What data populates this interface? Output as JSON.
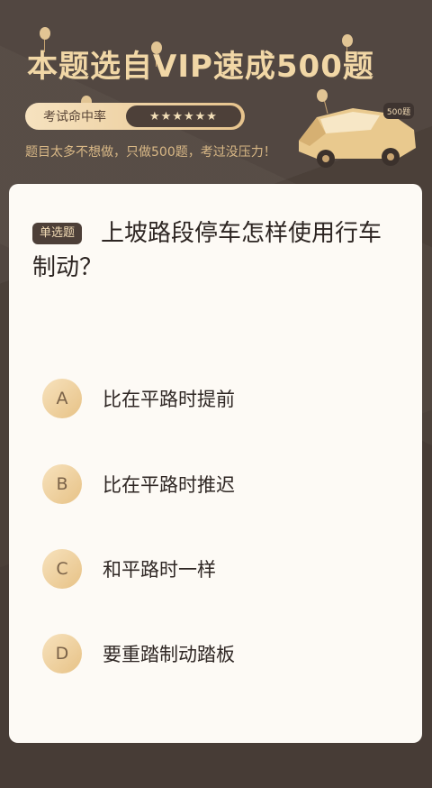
{
  "banner": {
    "title": "本题选自VIP速成500题",
    "rating_label": "考试命中率",
    "rating_stars": "★★★★★★",
    "subtitle": "题目太多不想做，只做500题，考过没压力！",
    "car_badge": "500题"
  },
  "question": {
    "type_label": "单选题",
    "text": "上坡路段停车怎样使用行车制动？"
  },
  "options": [
    {
      "letter": "A",
      "text": "比在平路时提前"
    },
    {
      "letter": "B",
      "text": "比在平路时推迟"
    },
    {
      "letter": "C",
      "text": "和平路时一样"
    },
    {
      "letter": "D",
      "text": "要重踏制动踏板"
    }
  ],
  "colors": {
    "background": "#4b4039",
    "card": "#fdfaf5",
    "title_gold": "#f1d7a6",
    "badge_dark": "#4d3f38"
  }
}
